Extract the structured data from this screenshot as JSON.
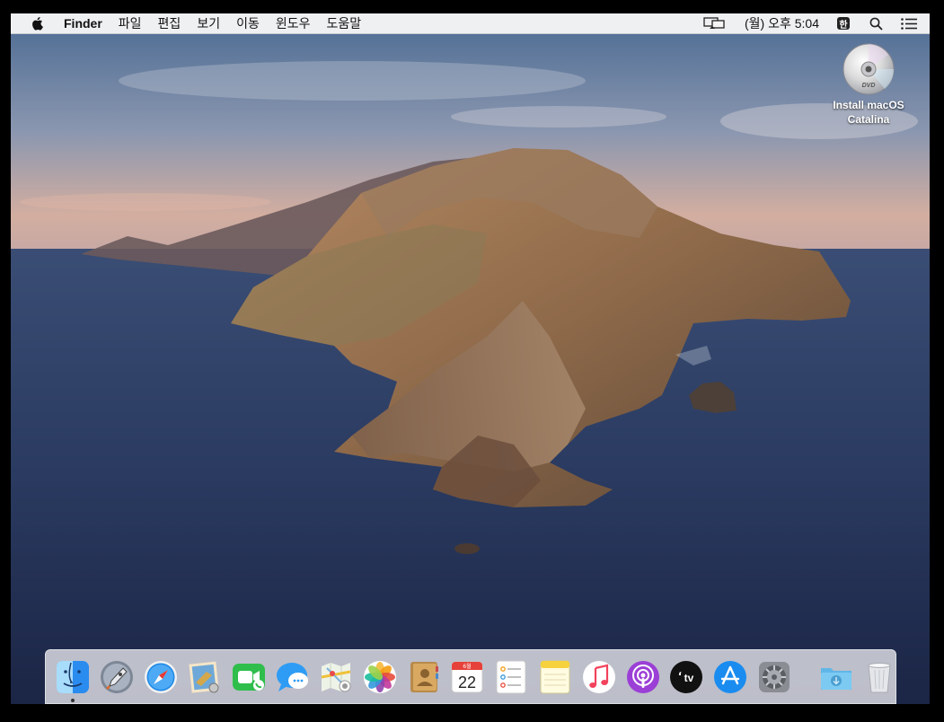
{
  "menubar": {
    "app_name": "Finder",
    "menus": [
      "파일",
      "편집",
      "보기",
      "이동",
      "윈도우",
      "도움말"
    ],
    "clock": "(월) 오후 5:04",
    "ime": "한"
  },
  "desktop": {
    "dvd_label_line1": "Install macOS",
    "dvd_label_line2": "Catalina",
    "dvd_text": "DVD"
  },
  "dock": {
    "apps": [
      "finder-icon",
      "launchpad-icon",
      "safari-icon",
      "mail-icon",
      "facetime-icon",
      "messages-icon",
      "maps-icon",
      "photos-icon",
      "contacts-icon",
      "calendar-icon",
      "reminders-icon",
      "notes-icon",
      "music-icon",
      "podcasts-icon",
      "apple-tv-icon",
      "app-store-icon",
      "system-preferences-icon"
    ],
    "calendar_month": "6월",
    "calendar_day": "22",
    "tv_label": "tv",
    "right": [
      "downloads-folder-icon",
      "trash-icon"
    ]
  }
}
